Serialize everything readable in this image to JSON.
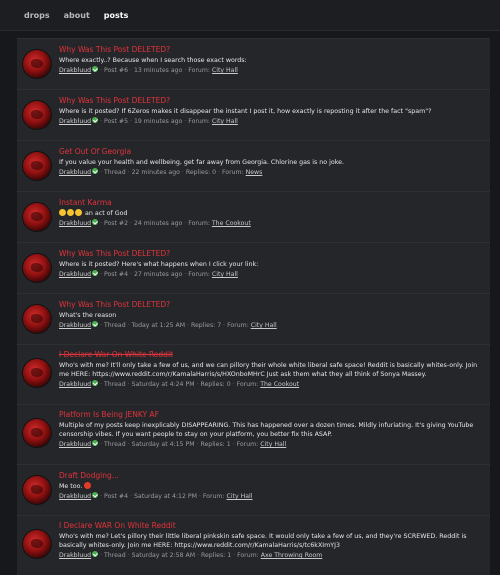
{
  "nav": {
    "items": [
      "drops",
      "about",
      "posts"
    ],
    "active": "posts"
  },
  "posts": [
    {
      "title": "Why Was This Post DELETED?",
      "snippet": "Where exactly..? Because when I search those exact words:",
      "user": "Drakbluud",
      "kind": "Post #6",
      "time": "13 minutes ago",
      "replies": "",
      "forum_prefix": "Forum:",
      "forum": "City Hall"
    },
    {
      "title": "Why Was This Post DELETED?",
      "snippet": "Where is it posted? If 6Zeros makes it disappear the instant I post it, how exactly is reposting it after the fact \"spam\"?",
      "user": "Drakbluud",
      "kind": "Post #5",
      "time": "19 minutes ago",
      "replies": "",
      "forum_prefix": "Forum:",
      "forum": "City Hall"
    },
    {
      "title": "Get Out Of Georgia",
      "snippet": "If you value your health and wellbeing, get far away from Georgia. Chlorine gas is no joke.",
      "user": "Drakbluud",
      "kind": "Thread",
      "time": "22 minutes ago",
      "replies": "Replies: 0",
      "forum_prefix": "Forum:",
      "forum": "News"
    },
    {
      "title": "Instant Karma",
      "snippet": "an act of God",
      "user": "Drakbluud",
      "kind": "Post #2",
      "time": "24 minutes ago",
      "replies": "",
      "forum_prefix": "Forum:",
      "forum": "The Cookout"
    },
    {
      "title": "Why Was This Post DELETED?",
      "snippet": "Where is it posted? Here's what happens when I click your link:",
      "user": "Drakbluud",
      "kind": "Post #4",
      "time": "27 minutes ago",
      "replies": "",
      "forum_prefix": "Forum:",
      "forum": "City Hall"
    },
    {
      "title": "Why Was This Post DELETED?",
      "snippet": "What's the reason",
      "user": "Drakbluud",
      "kind": "Thread",
      "time": "Today at 1:25 AM",
      "replies": "Replies: 7",
      "forum_prefix": "Forum:",
      "forum": "City Hall"
    },
    {
      "title": "I Declare War On White Reddit",
      "snippet": "Who's with me? It'll only take a few of us, and we can pillory their whole white liberal safe space! Reddit is basically whites-only. Join me HERE: https://www.reddit.com/r/KamalaHarris/s/HXOnboMHrC Just ask them what they all think of Sonya Massey.",
      "user": "Drakbluud",
      "kind": "Thread",
      "time": "Saturday at 4:24 PM",
      "replies": "Replies: 0",
      "forum_prefix": "Forum:",
      "forum": "The Cookout"
    },
    {
      "title": "Platform Is Being JENKY AF",
      "snippet": "Multiple of my posts keep inexplicably DISAPPEARING. This has happened over a dozen times. Mildly infuriating. It's giving YouTube censorship vibes. If you want people to stay on your platform, you better fix this ASAP.",
      "user": "Drakbluud",
      "kind": "Thread",
      "time": "Saturday at 4:15 PM",
      "replies": "Replies: 1",
      "forum_prefix": "Forum:",
      "forum": "City Hall"
    },
    {
      "title": "Draft Dodging...",
      "snippet": "Me too.",
      "user": "Drakbluud",
      "kind": "Post #4",
      "time": "Saturday at 4:12 PM",
      "replies": "",
      "forum_prefix": "Forum:",
      "forum": "City Hall"
    },
    {
      "title": "I Declare WAR On White Reddit",
      "snippet": "Who's with me? Let's pillory their little liberal pinkskin safe space. It would only take a few of us, and they're SCREWED. Reddit is basically whites-only. Join me HERE: https://www.reddit.com/r/KamalaHarris/s/tc6kXImYJ3",
      "user": "Drakbluud",
      "kind": "Thread",
      "time": "Saturday at 2:58 AM",
      "replies": "Replies: 1",
      "forum_prefix": "Forum:",
      "forum": "Axe Throwing Room"
    }
  ]
}
